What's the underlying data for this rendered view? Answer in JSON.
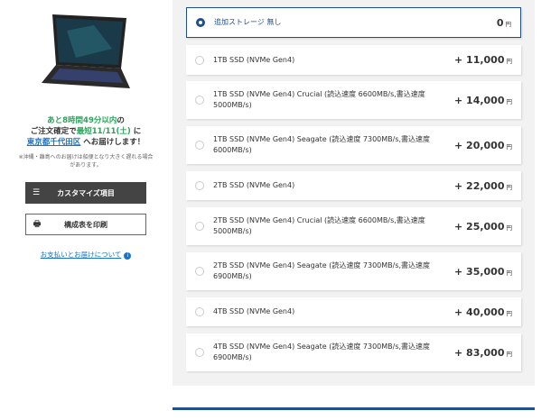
{
  "left": {
    "delivery": {
      "line1_pre": "あと8時間49分以内",
      "line1_post": "の",
      "line2_pre": "ご注文確定で",
      "line2_date": "最短11/11(土)",
      "line2_post": " に",
      "line3_link": "東京都千代田区",
      "line3_post": " へお届けします！"
    },
    "note": "※沖縄・離島へのお届けは船便となり大きく遅れる場合があります。",
    "customize_button": "カスタマイズ項目",
    "print_button": "構成表を印刷",
    "info_link": "お支払いとお届けについて"
  },
  "options": [
    {
      "name": "追加ストレージ 無し",
      "price": "0",
      "selected": true
    },
    {
      "name": "1TB SSD (NVMe Gen4)",
      "price": "+ 11,000"
    },
    {
      "name": "1TB SSD (NVMe Gen4) Crucial (読込速度 6600MB/s,書込速度 5000MB/s)",
      "price": "+ 14,000"
    },
    {
      "name": "1TB SSD (NVMe Gen4) Seagate (読込速度 7300MB/s,書込速度 6000MB/s)",
      "price": "+ 20,000"
    },
    {
      "name": "2TB SSD (NVMe Gen4)",
      "price": "+ 22,000"
    },
    {
      "name": "2TB SSD (NVMe Gen4) Crucial (読込速度 6600MB/s,書込速度 5000MB/s)",
      "price": "+ 25,000"
    },
    {
      "name": "2TB SSD (NVMe Gen4) Seagate (読込速度 7300MB/s,書込速度 6900MB/s)",
      "price": "+ 35,000"
    },
    {
      "name": "4TB SSD (NVMe Gen4)",
      "price": "+ 40,000"
    },
    {
      "name": "4TB SSD (NVMe Gen4) Seagate (読込速度 7300MB/s,書込速度 6900MB/s)",
      "price": "+ 83,000"
    }
  ],
  "currency": "円"
}
